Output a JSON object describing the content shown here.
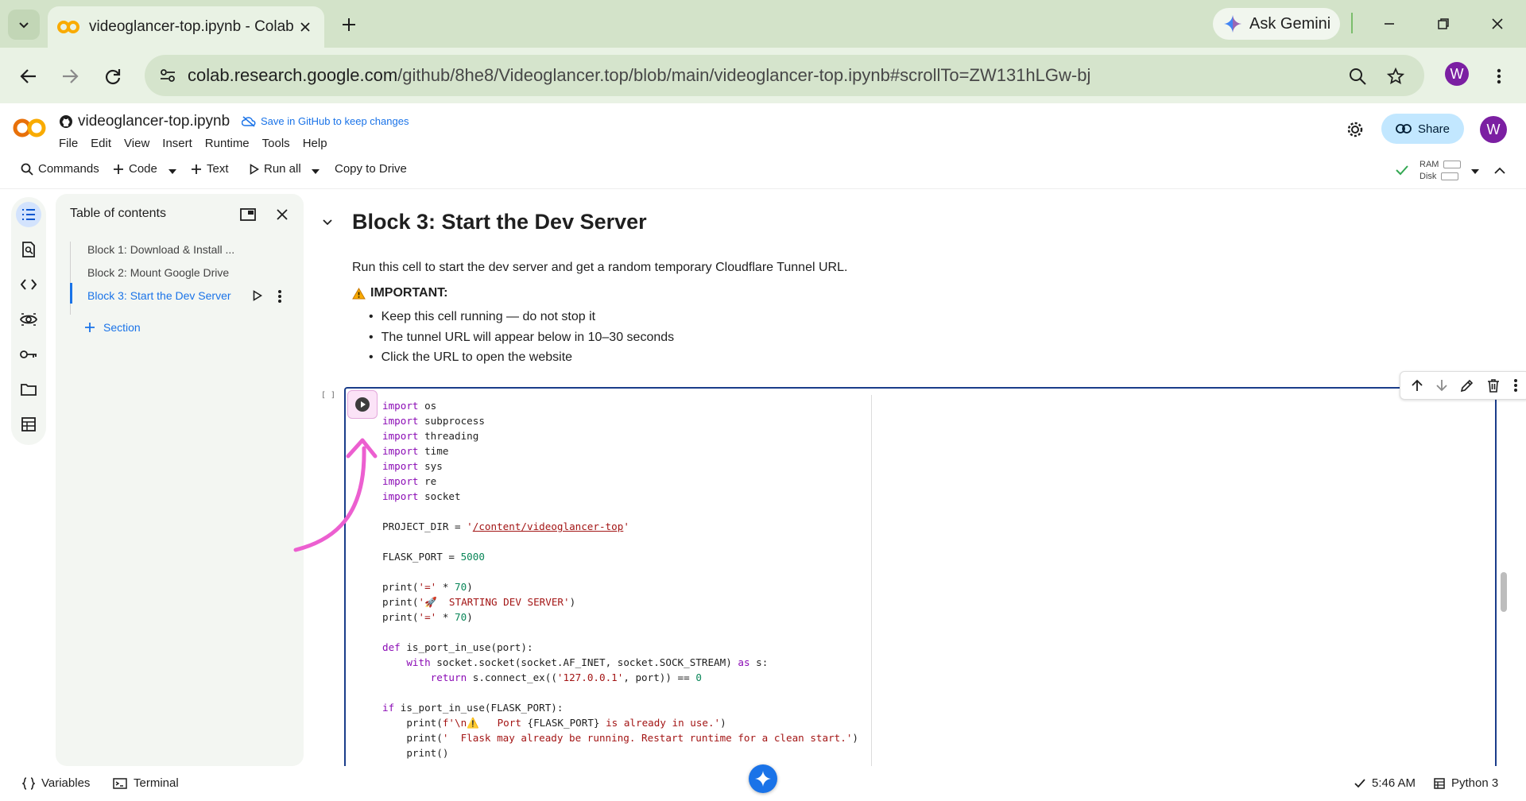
{
  "browser": {
    "tab_title": "videoglancer-top.ipynb - Colab",
    "ask_gemini": "Ask Gemini",
    "url_host": "colab.research.google.com",
    "url_path": "/github/8he8/Videoglancer.top/blob/main/videoglancer-top.ipynb#scrollTo=ZW131hLGw-bj",
    "profile_initial": "W"
  },
  "colab": {
    "notebook_name": "videoglancer-top.ipynb",
    "save_github": "Save in GitHub to keep changes",
    "menu": [
      "File",
      "Edit",
      "View",
      "Insert",
      "Runtime",
      "Tools",
      "Help"
    ],
    "share_label": "Share",
    "avatar_initial": "W"
  },
  "commandbar": {
    "commands": "Commands",
    "code": "Code",
    "text": "Text",
    "run_all": "Run all",
    "copy_to_drive": "Copy to Drive",
    "ram": "RAM",
    "disk": "Disk"
  },
  "toc": {
    "title": "Table of contents",
    "items": [
      "Block 1: Download & Install ...",
      "Block 2: Mount Google Drive",
      "Block 3: Start the Dev Server"
    ],
    "section_label": "Section"
  },
  "content": {
    "heading": "Block 3: Start the Dev Server",
    "intro": "Run this cell to start the dev server and get a random temporary Cloudflare Tunnel URL.",
    "important": "IMPORTANT:",
    "bullets": [
      "Keep this cell running — do not stop it",
      "The tunnel URL will appear below in 10–30 seconds",
      "Click the URL to open the website"
    ],
    "exec_count": "[ ]"
  },
  "code_lines": [
    [
      [
        "kw",
        "import"
      ],
      [
        "t",
        " os"
      ]
    ],
    [
      [
        "kw",
        "import"
      ],
      [
        "t",
        " subprocess"
      ]
    ],
    [
      [
        "kw",
        "import"
      ],
      [
        "t",
        " threading"
      ]
    ],
    [
      [
        "kw",
        "import"
      ],
      [
        "t",
        " time"
      ]
    ],
    [
      [
        "kw",
        "import"
      ],
      [
        "t",
        " sys"
      ]
    ],
    [
      [
        "kw",
        "import"
      ],
      [
        "t",
        " re"
      ]
    ],
    [
      [
        "kw",
        "import"
      ],
      [
        "t",
        " socket"
      ]
    ],
    [],
    [
      [
        "t",
        "PROJECT_DIR = "
      ],
      [
        "str",
        "'"
      ],
      [
        "stru",
        "/content/videoglancer-top"
      ],
      [
        "str",
        "'"
      ]
    ],
    [],
    [
      [
        "t",
        "FLASK_PORT = "
      ],
      [
        "num",
        "5000"
      ]
    ],
    [],
    [
      [
        "t",
        "print("
      ],
      [
        "str",
        "'=' "
      ],
      [
        "t",
        "* "
      ],
      [
        "num",
        "70"
      ],
      [
        "t",
        ")"
      ]
    ],
    [
      [
        "t",
        "print("
      ],
      [
        "str",
        "'🚀  STARTING DEV SERVER'"
      ],
      [
        "t",
        ")"
      ]
    ],
    [
      [
        "t",
        "print("
      ],
      [
        "str",
        "'=' "
      ],
      [
        "t",
        "* "
      ],
      [
        "num",
        "70"
      ],
      [
        "t",
        ")"
      ]
    ],
    [],
    [
      [
        "kw",
        "def"
      ],
      [
        "t",
        " is_port_in_use(port):"
      ]
    ],
    [
      [
        "t",
        "    "
      ],
      [
        "kw",
        "with"
      ],
      [
        "t",
        " socket.socket(socket.AF_INET, socket.SOCK_STREAM) "
      ],
      [
        "kw",
        "as"
      ],
      [
        "t",
        " s:"
      ]
    ],
    [
      [
        "t",
        "        "
      ],
      [
        "kw",
        "return"
      ],
      [
        "t",
        " s.connect_ex(("
      ],
      [
        "str",
        "'127.0.0.1'"
      ],
      [
        "t",
        ", port)) == "
      ],
      [
        "num",
        "0"
      ]
    ],
    [],
    [
      [
        "kw",
        "if"
      ],
      [
        "t",
        " is_port_in_use(FLASK_PORT):"
      ]
    ],
    [
      [
        "t",
        "    print("
      ],
      [
        "str",
        "f'\\n⚠️   Port "
      ],
      [
        "t",
        "{FLASK_PORT}"
      ],
      [
        "str",
        " is already in use.'"
      ],
      [
        "t",
        ")"
      ]
    ],
    [
      [
        "t",
        "    print("
      ],
      [
        "str",
        "'  Flask may already be running. Restart runtime for a clean start.'"
      ],
      [
        "t",
        ")"
      ]
    ],
    [
      [
        "t",
        "    print()"
      ]
    ]
  ],
  "statusbar": {
    "variables": "Variables",
    "terminal": "Terminal",
    "time": "5:46 AM",
    "kernel": "Python 3"
  },
  "colors": {
    "accent": "#1a73e8",
    "keyword": "#8b0cb5",
    "string": "#a31515",
    "number": "#098658",
    "annotation_arrow": "#ec5fd0"
  }
}
